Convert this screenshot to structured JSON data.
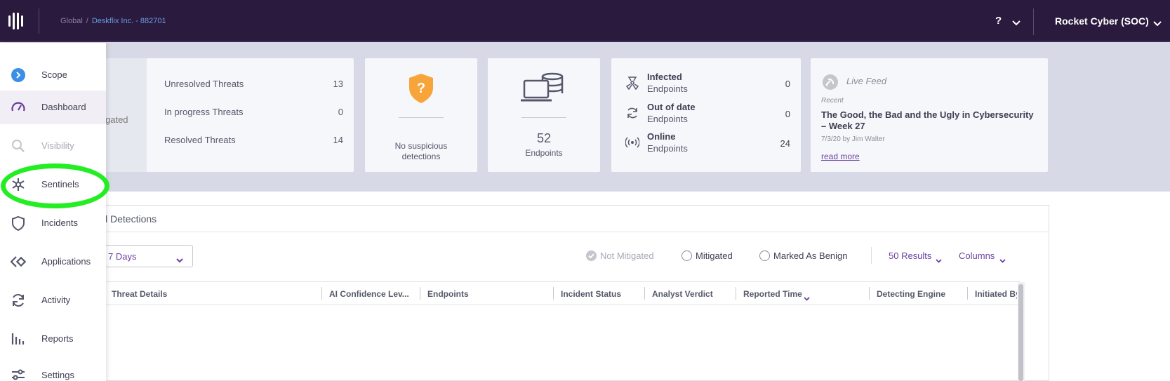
{
  "header": {
    "breadcrumb_root": "Global",
    "breadcrumb_sep": "/",
    "breadcrumb_current": "Deskflix Inc. - 882701",
    "help_label": "?",
    "account_name": "Rocket Cyber (SOC)"
  },
  "sidebar": {
    "items": [
      {
        "label": "Scope",
        "icon": "scope-icon"
      },
      {
        "label": "Dashboard",
        "icon": "dashboard-icon"
      },
      {
        "label": "Visibility",
        "icon": "visibility-icon"
      },
      {
        "label": "Sentinels",
        "icon": "sentinels-icon"
      },
      {
        "label": "Incidents",
        "icon": "incidents-icon"
      },
      {
        "label": "Applications",
        "icon": "applications-icon"
      },
      {
        "label": "Activity",
        "icon": "activity-icon"
      },
      {
        "label": "Reports",
        "icon": "reports-icon"
      },
      {
        "label": "Settings",
        "icon": "settings-icon"
      }
    ]
  },
  "partial_card": {
    "text": "gated"
  },
  "threats": {
    "unresolved_label": "Unresolved Threats",
    "unresolved_value": "13",
    "inprogress_label": "In progress Threats",
    "inprogress_value": "0",
    "resolved_label": "Resolved Threats",
    "resolved_value": "14"
  },
  "suspicious": {
    "line1": "No suspicious",
    "line2": "detections"
  },
  "endpoints": {
    "count": "52",
    "label": "Endpoints"
  },
  "endpoint_status": {
    "infected_l1": "Infected",
    "infected_l2": "Endpoints",
    "infected_value": "0",
    "outdated_l1": "Out of date",
    "outdated_l2": "Endpoints",
    "outdated_value": "0",
    "online_l1": "Online",
    "online_l2": "Endpoints",
    "online_value": "24"
  },
  "live_feed": {
    "title": "Live Feed",
    "recent": "Recent",
    "headline": "The Good, the Bad and the Ugly in Cybersecurity – Week 27",
    "meta": "7/3/20 by Jim Walter",
    "read_more": "read more"
  },
  "detections": {
    "title": "l Detections",
    "date_range": "7 Days",
    "filter_not_mitigated": "Not Mitigated",
    "filter_mitigated": "Mitigated",
    "filter_benign": "Marked As Benign",
    "results": "50 Results",
    "columns_label": "Columns",
    "headers": [
      "Threat Details",
      "AI Confidence Lev...",
      "Endpoints",
      "Incident Status",
      "Analyst Verdict",
      "Reported Time",
      "Detecting Engine",
      "Initiated By"
    ]
  },
  "colors": {
    "topbar": "#2a1a3e",
    "accent": "#6b3fa0",
    "breadcrumb_link": "#6a9ce0",
    "shield": "#f7a53a",
    "highlight": "#22ee22"
  }
}
